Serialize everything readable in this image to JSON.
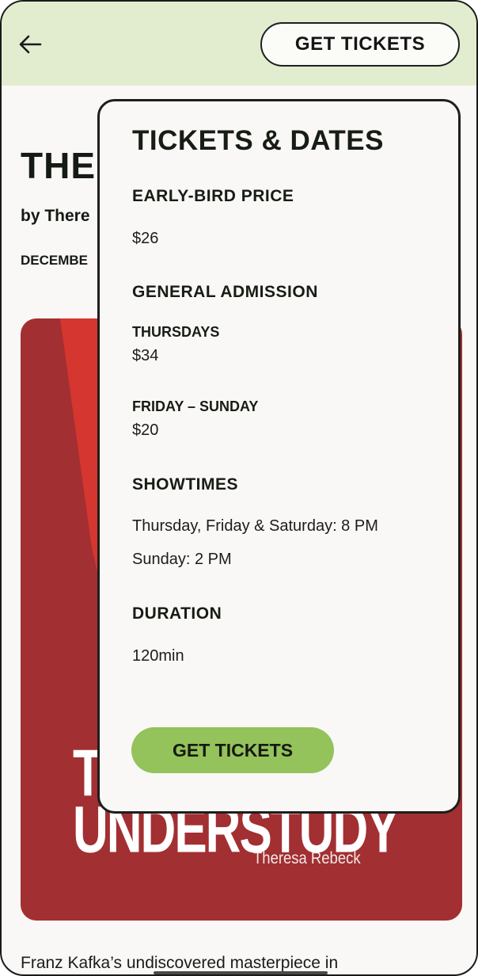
{
  "header": {
    "back_icon": "arrow-left-icon",
    "get_tickets_label": "GET TICKETS"
  },
  "show": {
    "title": "THE",
    "author_line": "by There",
    "dates": "DECEMBE",
    "description": "Franz Kafka’s undiscovered masterpiece in"
  },
  "poster": {
    "title_text": "THE\nUNDERSTUDY",
    "author": "Theresa Rebeck"
  },
  "panel": {
    "title": "TICKETS & DATES",
    "early_bird": {
      "heading": "EARLY-BIRD PRICE",
      "price": "$26"
    },
    "general": {
      "heading": "GENERAL ADMISSION",
      "thursdays": {
        "label": "THURSDAYS",
        "price": "$34"
      },
      "weekend": {
        "label": "FRIDAY – SUNDAY",
        "price": "$20"
      }
    },
    "showtimes": {
      "heading": "SHOWTIMES",
      "line1": "Thursday, Friday & Saturday: 8 PM",
      "line2": "Sunday: 2 PM"
    },
    "duration": {
      "heading": "DURATION",
      "value": "120min"
    },
    "button_label": "GET TICKETS"
  },
  "colors": {
    "header_bg": "#e2edcf",
    "poster_red": "#a22f31",
    "accent_green": "#94c25b"
  }
}
